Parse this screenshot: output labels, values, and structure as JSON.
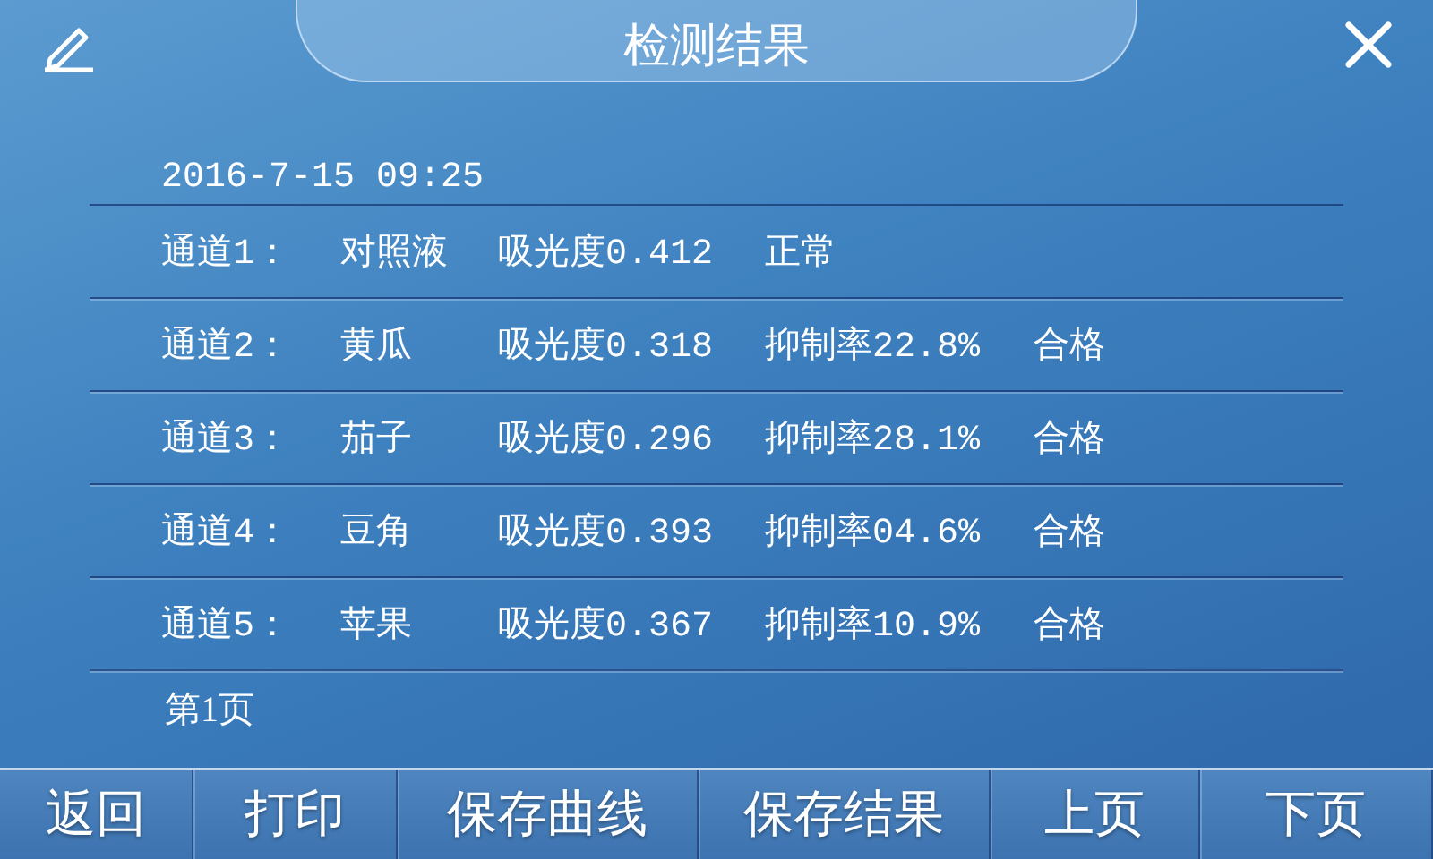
{
  "title": "检测结果",
  "timestamp": "2016-7-15 09:25",
  "results": [
    {
      "channel": "通道1：",
      "sample": "对照液",
      "absorbance": "吸光度0.412",
      "verdict": "正常"
    },
    {
      "channel": "通道2：",
      "sample": "黄瓜",
      "absorbance": "吸光度0.318",
      "inhibition": "抑制率22.8%",
      "verdict": "合格"
    },
    {
      "channel": "通道3：",
      "sample": "茄子",
      "absorbance": "吸光度0.296",
      "inhibition": "抑制率28.1%",
      "verdict": "合格"
    },
    {
      "channel": "通道4：",
      "sample": "豆角",
      "absorbance": "吸光度0.393",
      "inhibition": "抑制率04.6%",
      "verdict": "合格"
    },
    {
      "channel": "通道5：",
      "sample": "苹果",
      "absorbance": "吸光度0.367",
      "inhibition": "抑制率10.9%",
      "verdict": "合格"
    }
  ],
  "page_label": "第1页",
  "buttons": [
    "返回",
    "打印",
    "保存曲线",
    "保存结果",
    "上页",
    "下页"
  ]
}
